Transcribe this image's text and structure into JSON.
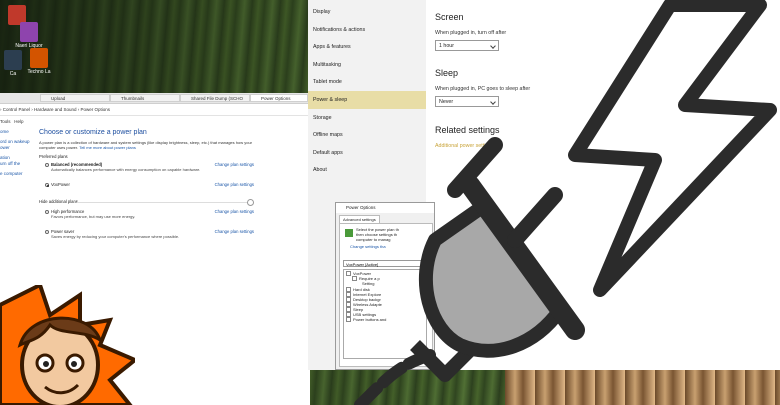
{
  "desktop": {
    "icons": [
      {
        "label": "",
        "color": "#c0392b",
        "icon": "app-red-icon"
      },
      {
        "label": "Naeri Liquor",
        "color": "#8e44ad",
        "icon": "app-icon"
      },
      {
        "label": "Ca",
        "color": "#2c3e50",
        "icon": "app-icon"
      },
      {
        "label": "Techno La",
        "color": "#d35400",
        "icon": "app-icon"
      }
    ]
  },
  "control_panel": {
    "tabs": [
      "Upload",
      "Thumbnails",
      "Shared File Dump (SCHO",
      "Power Options"
    ],
    "address": "› Control Panel › Hardware and Sound › Power Options",
    "menu": [
      "Tools",
      "Help"
    ],
    "side_links": [
      "ome",
      "ord on wakeup",
      "ower",
      "ation",
      "urn off the",
      "e computer"
    ],
    "title": "Choose or customize a power plan",
    "intro": "A power plan is a collection of hardware and system settings (like display brightness, sleep, etc.) that manages how your computer uses power.",
    "intro_link": "Tell me more about power plans",
    "preferred_heading": "Preferred plans",
    "plans": [
      {
        "name": "Balanced (recommended)",
        "desc": "Automatically balances performance with energy consumption on capable hardware.",
        "link": "Change plan settings",
        "selected": false
      },
      {
        "name": "VoxPower",
        "desc": "",
        "link": "Change plan settings",
        "selected": true
      }
    ],
    "hide_label": "Hide additional plans",
    "additional_plans": [
      {
        "name": "High performance",
        "desc": "Favors performance, but may use more energy.",
        "link": "Change plan settings",
        "selected": false
      },
      {
        "name": "Power saver",
        "desc": "Saves energy by reducing your computer's performance where possible.",
        "link": "Change plan settings",
        "selected": false
      }
    ]
  },
  "settings": {
    "nav": [
      {
        "label": "Display",
        "active": false
      },
      {
        "label": "Notifications & actions",
        "active": false
      },
      {
        "label": "Apps & features",
        "active": false
      },
      {
        "label": "Multitasking",
        "active": false
      },
      {
        "label": "Tablet mode",
        "active": false
      },
      {
        "label": "Power & sleep",
        "active": true
      },
      {
        "label": "Storage",
        "active": false
      },
      {
        "label": "Offline maps",
        "active": false
      },
      {
        "label": "Default apps",
        "active": false
      },
      {
        "label": "About",
        "active": false
      }
    ],
    "screen_heading": "Screen",
    "screen_label": "When plugged in, turn off after",
    "screen_value": "1 hour",
    "sleep_heading": "Sleep",
    "sleep_label": "When plugged in, PC goes to sleep after",
    "sleep_value": "Never",
    "related_heading": "Related settings",
    "related_link": "Additional power settings",
    "active_color": "#e8dda6",
    "link_color": "#c9a43a"
  },
  "dialog": {
    "title": "Power Options",
    "tab": "Advanced settings",
    "desc_lines": [
      "Select the power plan th",
      "then choose settings th",
      "computer to manag"
    ],
    "desc_link": "Change settings tha",
    "plan": "VoxPower [Active]",
    "tree": [
      "VoxPower",
      "Require a p",
      "Setting",
      "Hard disk",
      "Internet Explore",
      "Desktop backgr",
      "Wireless Adapte",
      "Sleep",
      "USB settings",
      "Power buttons and"
    ]
  },
  "overlays": {
    "bolt_icon": "lightning-bolt-icon",
    "plug_icon": "power-plug-icon",
    "avatar_icon": "cartoon-avatar"
  }
}
